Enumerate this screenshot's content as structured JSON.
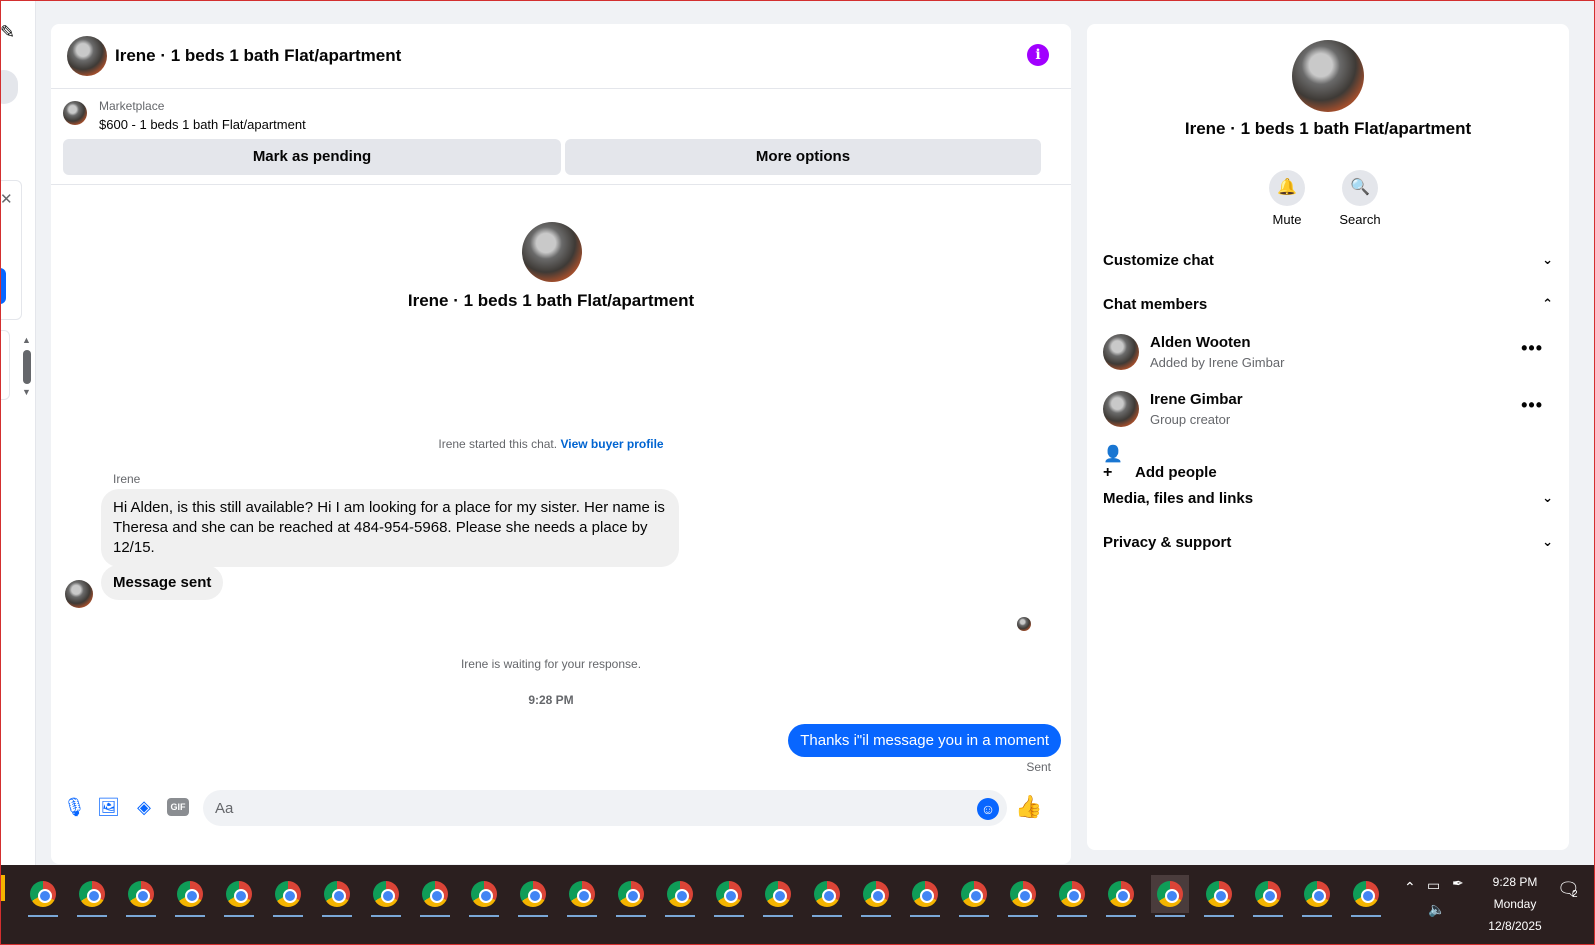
{
  "chat": {
    "title": "Irene · 1 beds 1 bath Flat/apartment",
    "listing": {
      "source": "Marketplace",
      "price_line": "$600 - 1 beds 1 bath Flat/apartment",
      "mark_pending": "Mark as pending",
      "more_options": "More options"
    },
    "intro_title": "Irene · 1 beds 1 bath Flat/apartment",
    "started_text": "Irene started this chat.",
    "view_profile": "View buyer profile",
    "sender_name": "Irene",
    "incoming_message": "Hi Alden, is this still available? Hi I am looking for a place for my sister.  Her name is Theresa and she can be reached at 484-954-5968.  Please she needs a place by 12/15.",
    "incoming_message_2": "Message sent",
    "waiting_text": "Irene is waiting for your response.",
    "timestamp": "9:28 PM",
    "outgoing_message": "Thanks i\"il message you in a moment",
    "sent_label": "Sent",
    "composer_placeholder": "Aa",
    "gif_label": "GIF"
  },
  "details": {
    "title": "Irene · 1 beds 1 bath Flat/apartment",
    "mute_label": "Mute",
    "search_label": "Search",
    "customize_chat": "Customize chat",
    "chat_members": "Chat members",
    "members": [
      {
        "name": "Alden Wooten",
        "note": "Added by Irene Gimbar"
      },
      {
        "name": "Irene Gimbar",
        "note": "Group creator"
      }
    ],
    "add_people": "Add people",
    "media_files": "Media, files and links",
    "privacy_support": "Privacy & support"
  },
  "taskbar": {
    "time": "9:28 PM",
    "day": "Monday",
    "date": "12/8/2025",
    "notification_count": "2"
  },
  "colors": {
    "accent": "#0866ff",
    "info": "#a100ff",
    "taskbar": "#2b1f1f"
  }
}
